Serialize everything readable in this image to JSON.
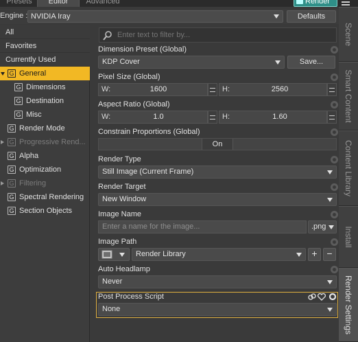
{
  "tabs": {
    "presets": "Presets",
    "editor": "Editor",
    "advanced": "Advanced"
  },
  "render_button": "Render",
  "engine": {
    "label": "Engine :",
    "value": "NVIDIA Iray",
    "defaults_label": "Defaults"
  },
  "tree": {
    "all": "All",
    "favorites": "Favorites",
    "currently_used": "Currently Used",
    "items": [
      {
        "label": "General",
        "g": "G"
      },
      {
        "label": "Dimensions",
        "g": "G"
      },
      {
        "label": "Destination",
        "g": "G"
      },
      {
        "label": "Misc",
        "g": "G"
      },
      {
        "label": "Render Mode",
        "g": "G"
      },
      {
        "label": "Progressive Rend...",
        "g": "G"
      },
      {
        "label": "Alpha",
        "g": "G"
      },
      {
        "label": "Optimization",
        "g": "G"
      },
      {
        "label": "Filtering",
        "g": "G"
      },
      {
        "label": "Spectral Rendering",
        "g": "G"
      },
      {
        "label": "Section Objects",
        "g": "G"
      }
    ]
  },
  "search": {
    "placeholder": "Enter text to filter by..."
  },
  "props": {
    "dimension_preset": {
      "label": "Dimension Preset (Global)",
      "value": "KDP Cover",
      "save_label": "Save..."
    },
    "pixel_size": {
      "label": "Pixel Size (Global)",
      "w_label": "W:",
      "w_value": "1600",
      "h_label": "H:",
      "h_value": "2560"
    },
    "aspect_ratio": {
      "label": "Aspect Ratio (Global)",
      "w_label": "W:",
      "w_value": "1.0",
      "h_label": "H:",
      "h_value": "1.60"
    },
    "constrain": {
      "label": "Constrain Proportions (Global)",
      "value": "On"
    },
    "render_type": {
      "label": "Render Type",
      "value": "Still Image (Current Frame)"
    },
    "render_target": {
      "label": "Render Target",
      "value": "New Window"
    },
    "image_name": {
      "label": "Image Name",
      "placeholder": "Enter a name for the image...",
      "ext": ".png"
    },
    "image_path": {
      "label": "Image Path",
      "value": "Render Library",
      "plus": "+",
      "minus": "−"
    },
    "auto_headlamp": {
      "label": "Auto Headlamp",
      "value": "Never"
    },
    "post_process": {
      "label": "Post Process Script",
      "value": "None"
    }
  },
  "side_tabs": [
    "Scene",
    "Smart Content",
    "Content Library",
    "Install",
    "Render Settings"
  ],
  "colors": {
    "accent": "#f2b824",
    "render_button": "#2f8f88",
    "highlight": "#e0b040"
  }
}
